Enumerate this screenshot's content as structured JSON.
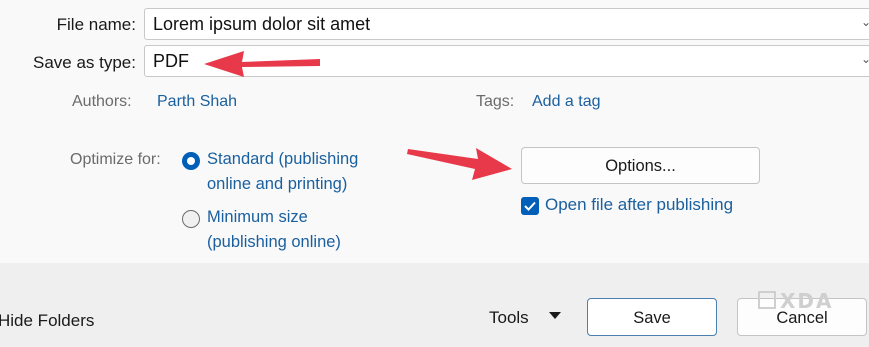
{
  "form": {
    "file_name_label": "File name:",
    "file_name_value": "Lorem ipsum dolor sit amet",
    "save_type_label": "Save as type:",
    "save_type_value": "PDF"
  },
  "meta": {
    "authors_label": "Authors:",
    "authors_value": "Parth Shah",
    "tags_label": "Tags:",
    "tags_value": "Add a tag"
  },
  "optimize": {
    "label": "Optimize for:",
    "standard_line1": "Standard (publishing",
    "standard_line2": "online and printing)",
    "minimum_line1": "Minimum size",
    "minimum_line2": "(publishing online)",
    "selected": "standard"
  },
  "options_button": "Options...",
  "open_after_label": "Open file after publishing",
  "open_after_checked": true,
  "footer": {
    "hide_folders": "Hide Folders",
    "tools": "Tools",
    "save": "Save",
    "cancel": "Cancel"
  },
  "watermark": "XDA",
  "colors": {
    "accent": "#005fb8",
    "link": "#1a5f9e",
    "annotation_arrow": "#e8394a"
  }
}
